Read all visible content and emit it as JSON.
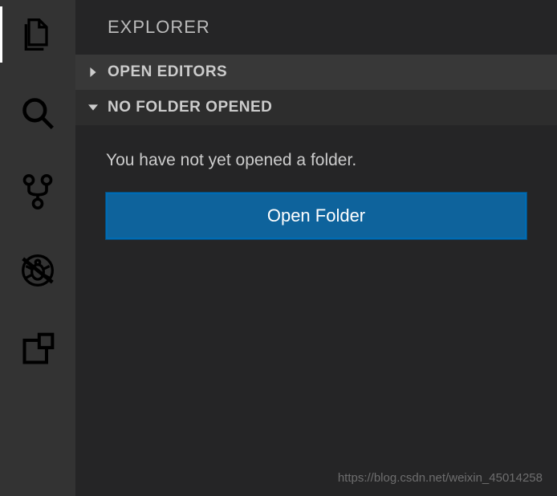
{
  "sidebar": {
    "title": "EXPLORER",
    "sections": {
      "openEditors": "OPEN EDITORS",
      "noFolder": "NO FOLDER OPENED"
    }
  },
  "content": {
    "emptyMessage": "You have not yet opened a folder.",
    "openFolderButton": "Open Folder"
  },
  "watermark": "https://blog.csdn.net/weixin_45014258",
  "activityBar": {
    "items": [
      "explorer",
      "search",
      "source-control",
      "debug",
      "extensions"
    ]
  }
}
